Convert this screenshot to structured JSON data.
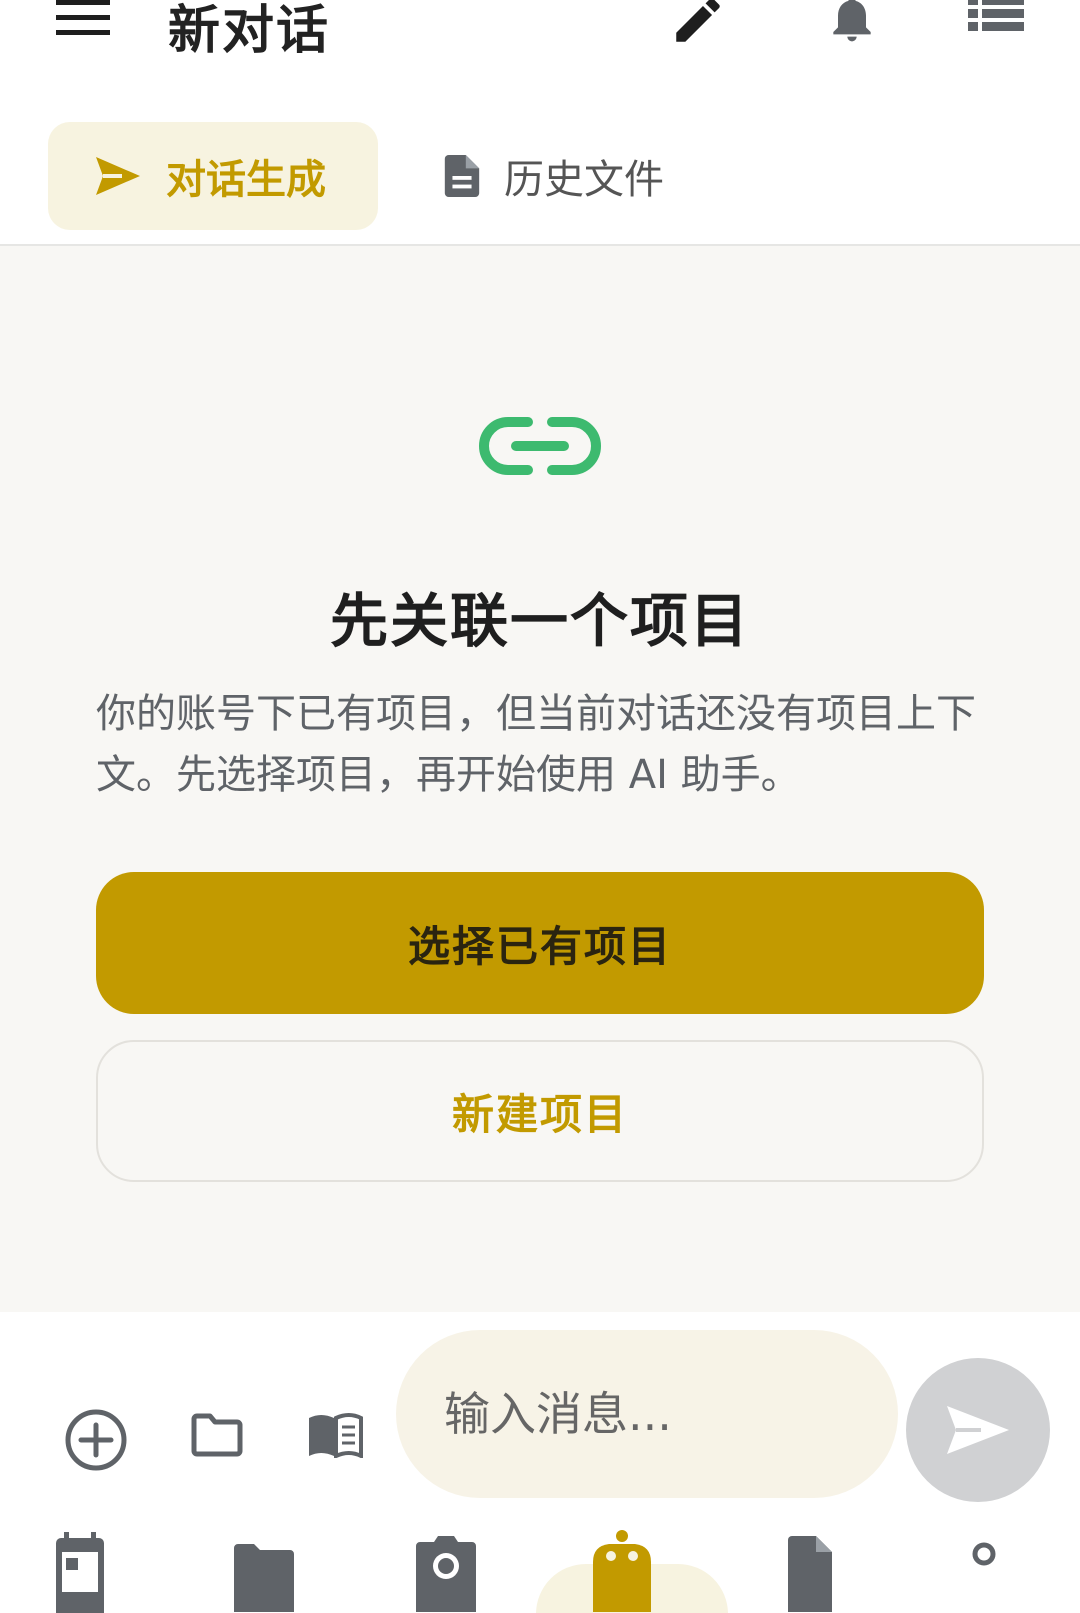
{
  "header": {
    "title": "新对话",
    "menu_icon": "menu-icon",
    "edit_icon": "edit-icon",
    "bell_icon": "bell-icon",
    "list_icon": "list-icon"
  },
  "tabs": [
    {
      "label": "对话生成",
      "icon": "send-icon",
      "active": true
    },
    {
      "label": "历史文件",
      "icon": "document-icon",
      "active": false
    }
  ],
  "main": {
    "icon": "link-icon",
    "heading": "先关联一个项目",
    "description": "你的账号下已有项目，但当前对话还没有项目上下文。先选择项目，再开始使用 AI 助手。",
    "primary_button": "选择已有项目",
    "secondary_button": "新建项目"
  },
  "composer": {
    "placeholder": "输入消息...",
    "add_icon": "add-circle-icon",
    "folder_icon": "folder-icon",
    "book_icon": "book-icon",
    "send_icon": "send-icon"
  },
  "bottom_nav": {
    "items": [
      "calendar-icon",
      "folder-icon",
      "camera-icon",
      "robot-icon",
      "document-icon",
      "person-icon"
    ],
    "active_index": 3
  },
  "colors": {
    "accent": "#c29a00",
    "accent_light": "#f7f3e0",
    "link_green": "#3dba6f",
    "background": "#f8f7f4",
    "send_disabled": "#d0d1d3"
  }
}
